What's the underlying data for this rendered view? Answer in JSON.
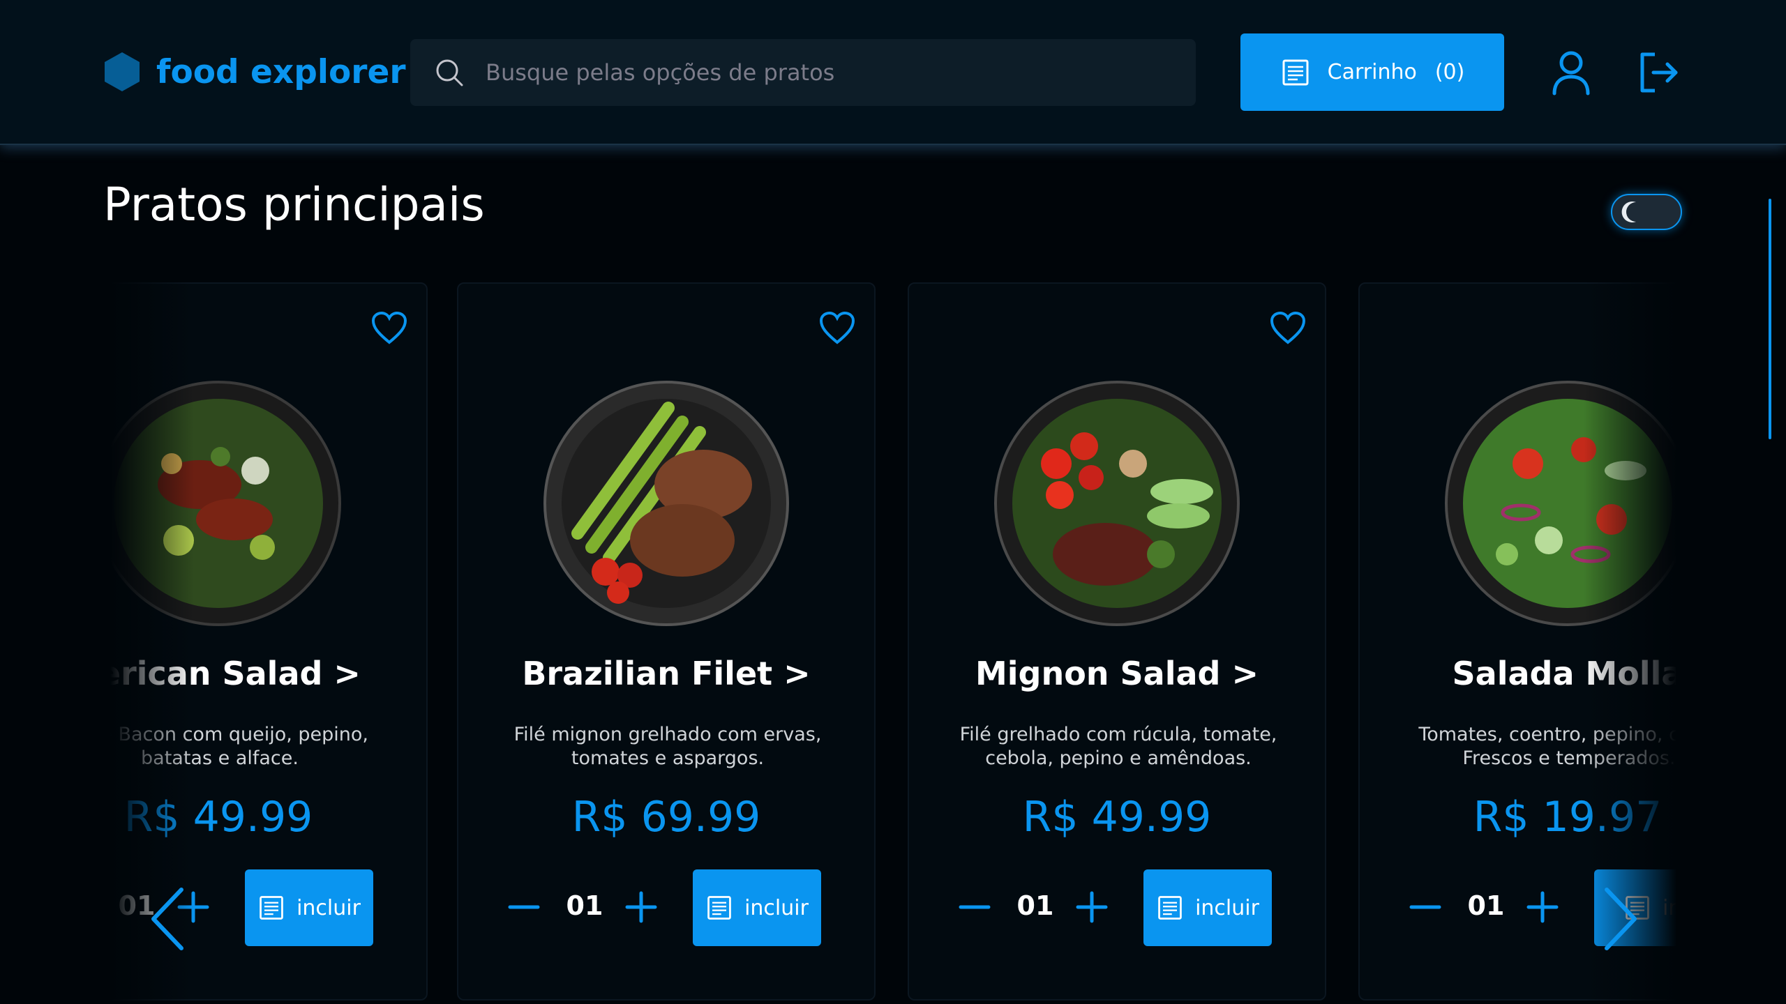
{
  "brand": {
    "name": "food explorer",
    "color": "#0a95f0"
  },
  "search": {
    "placeholder": "Busque pelas opções de pratos",
    "icon": "search-icon"
  },
  "cart": {
    "label": "Carrinho",
    "count": "(0)",
    "icon": "receipt-icon"
  },
  "header_icons": {
    "profile": "user-icon",
    "logout": "sign-out-icon"
  },
  "section": {
    "title": "Pratos principais"
  },
  "theme_toggle": {
    "icon": "moon-icon",
    "state": "dark"
  },
  "dishes": [
    {
      "name": "nerican Salad >",
      "description": "a de Bacon com queijo, pepino, batatas e alface.",
      "price": "R$ 49.99",
      "quantity": "01",
      "add_label": "incluir"
    },
    {
      "name": "Brazilian Filet >",
      "description": "Filé mignon grelhado com ervas, tomates e aspargos.",
      "price": "R$ 69.99",
      "quantity": "01",
      "add_label": "incluir"
    },
    {
      "name": "Mignon Salad >",
      "description": "Filé grelhado com rúcula, tomate, cebola, pepino e amêndoas.",
      "price": "R$ 49.99",
      "quantity": "01",
      "add_label": "incluir"
    },
    {
      "name": "Salada Molla",
      "description": "Tomates, coentro, pepino, cebol Frescos e temperados.",
      "price": "R$ 19.97",
      "quantity": "01",
      "add_label": "inc"
    }
  ],
  "colors": {
    "accent": "#0a95f0",
    "background": "#000509",
    "header": "#02111b"
  }
}
